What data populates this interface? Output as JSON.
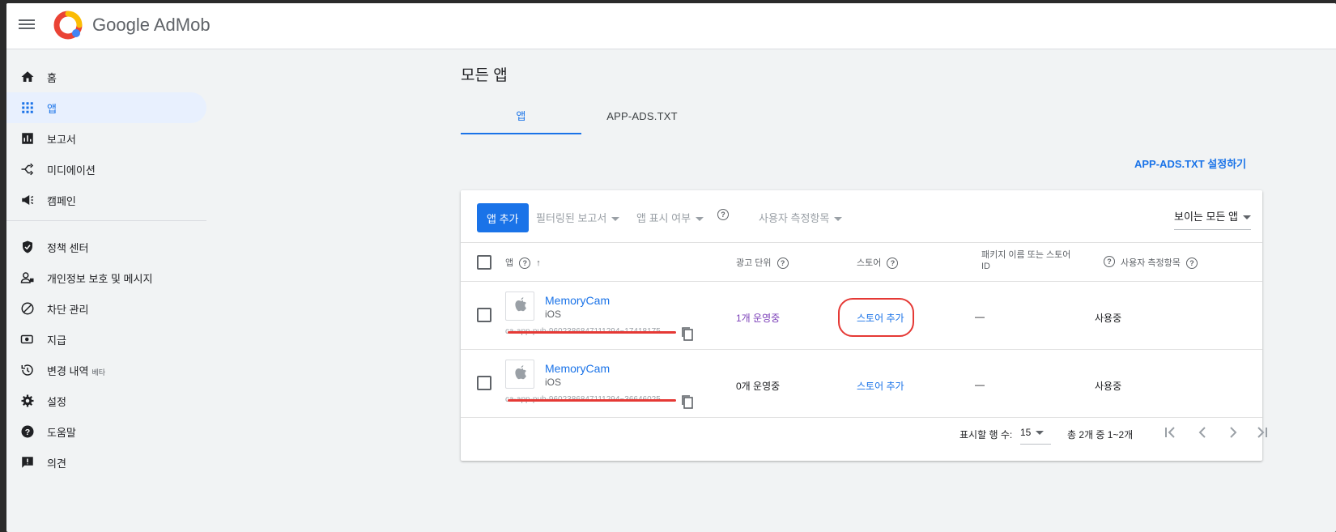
{
  "header": {
    "brand_prefix": "Google",
    "brand_name": "AdMob"
  },
  "sidebar": {
    "items": [
      {
        "label": "홈",
        "icon": "home-icon"
      },
      {
        "label": "앱",
        "icon": "apps-grid-icon",
        "active": true
      },
      {
        "label": "보고서",
        "icon": "bar-chart-icon"
      },
      {
        "label": "미디에이션",
        "icon": "mediation-icon"
      },
      {
        "label": "캠페인",
        "icon": "megaphone-icon"
      },
      {
        "label": "정책 센터",
        "icon": "shield-icon"
      },
      {
        "label": "개인정보 보호 및 메시지",
        "icon": "privacy-icon"
      },
      {
        "label": "차단 관리",
        "icon": "block-icon"
      },
      {
        "label": "지급",
        "icon": "payment-icon"
      },
      {
        "label": "변경 내역",
        "icon": "history-icon",
        "badge": "베타"
      },
      {
        "label": "설정",
        "icon": "gear-icon"
      },
      {
        "label": "도움말",
        "icon": "help-icon"
      },
      {
        "label": "의견",
        "icon": "feedback-icon"
      }
    ]
  },
  "main": {
    "title": "모든 앱",
    "tabs": [
      {
        "label": "앱"
      },
      {
        "label": "APP-ADS.TXT"
      }
    ],
    "ads_link": "APP-ADS.TXT 설정하기",
    "toolbar": {
      "add_app": "앱 추가",
      "filter_report": "필터링된 보고서",
      "app_visibility": "앱 표시 여부",
      "user_metrics": "사용자 측정항목",
      "visible_select": "보이는 모든 앱"
    },
    "columns": {
      "app": "앱",
      "ad_units": "광고 단위",
      "store": "스토어",
      "package": "패키지 이름 또는 스토어 ID",
      "user_metrics": "사용자 측정항목"
    },
    "rows": [
      {
        "name": "MemoryCam",
        "os": "iOS",
        "app_id": "ca-app-pub-9602386847111294~17418175",
        "ad_units": "1개 운영중",
        "store": "스토어 추가",
        "package": "—",
        "user_metrics": "사용중"
      },
      {
        "name": "MemoryCam",
        "os": "iOS",
        "app_id": "ca-app-pub-9602386847111294~36646025",
        "ad_units": "0개 운영중",
        "store": "스토어 추가",
        "package": "—",
        "user_metrics": "사용중"
      }
    ],
    "footer": {
      "rows_label": "표시할 행 수:",
      "rows_value": "15",
      "range": "총 2개 중 1~2개"
    }
  },
  "colors": {
    "accent": "#1a73e8",
    "highlight": "#e53935",
    "active_count": "#7b3fb8"
  }
}
